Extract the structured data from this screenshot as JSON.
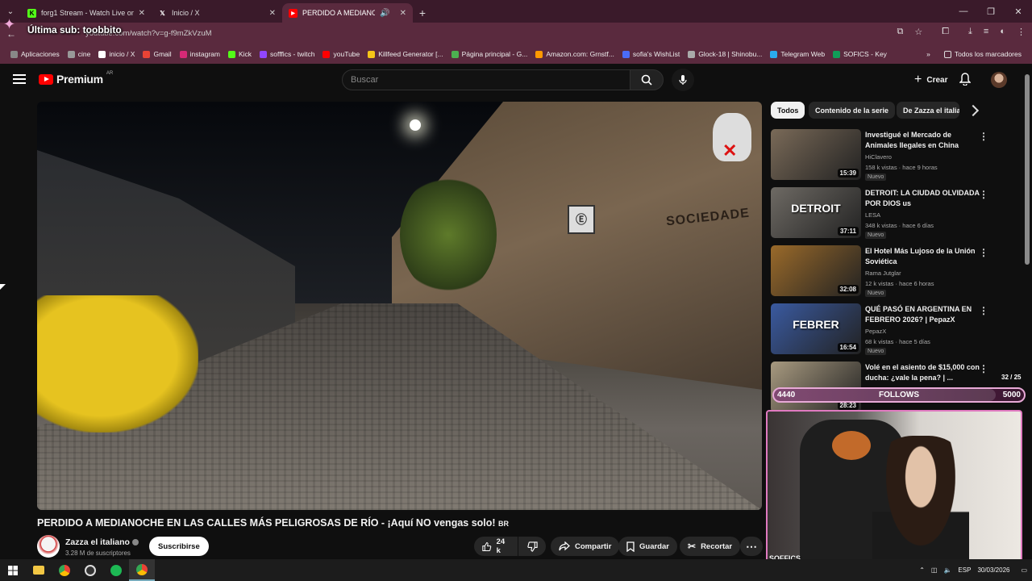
{
  "browser": {
    "tabs": [
      {
        "title": "forg1 Stream - Watch Live on K",
        "favicon": "kick-icon",
        "color": "#53fc18"
      },
      {
        "title": "Inicio / X",
        "favicon": "x-icon",
        "color": "#ffffff"
      },
      {
        "title": "PERDIDO A MEDIANOCHE",
        "favicon": "youtube-icon",
        "color": "#ff0000"
      }
    ],
    "url": "youtube.com/watch?v=g-f9mZkVzuM",
    "bookmarks": [
      {
        "label": "Aplicaciones",
        "color": "#888888"
      },
      {
        "label": "cine",
        "color": "#999999"
      },
      {
        "label": "inicio / X",
        "color": "#ffffff"
      },
      {
        "label": "Gmail",
        "color": "#ea4335"
      },
      {
        "label": "instagram",
        "color": "#d62976"
      },
      {
        "label": "Kick",
        "color": "#53fc18"
      },
      {
        "label": "sofffics - twitch",
        "color": "#9146ff"
      },
      {
        "label": "youTube",
        "color": "#ff0000"
      },
      {
        "label": "Killfeed Generator [...",
        "color": "#f5c518"
      },
      {
        "label": "Página principal - G...",
        "color": "#4caf50"
      },
      {
        "label": "Amazon.com: Grnstf...",
        "color": "#ff9900"
      },
      {
        "label": "sofia's WishList",
        "color": "#4a6cf7"
      },
      {
        "label": "Glock-18 | Shinobu...",
        "color": "#aaaaaa"
      },
      {
        "label": "Telegram Web",
        "color": "#2aabee"
      },
      {
        "label": "SOFICS - Key",
        "color": "#0f9d58"
      }
    ],
    "bookmarks_all": "Todos los marcadores"
  },
  "overlay": {
    "last_sub": "Última sub: toobbito",
    "follows_label": "FOLLOWS",
    "follows_current": "4440",
    "follows_goal": "5000",
    "follows_fraction": 0.888,
    "subs_count": "32 / 25",
    "cam_label": "SOFFICS"
  },
  "youtube": {
    "logo_text": "Premium",
    "logo_country": "AR",
    "search_placeholder": "Buscar",
    "create_label": "Crear",
    "video_title": "PERDIDO A MEDIANOCHE EN LAS CALLES MÁS PELIGROSAS DE RÍO - ¡Aquí NO vengas solo!",
    "video_title_flag": "BR",
    "channel_name": "Zazza el italiano",
    "channel_subs": "3.28 M de suscriptores",
    "subscribe_label": "Suscribirse",
    "likes": "24 k",
    "share_label": "Compartir",
    "save_label": "Guardar",
    "clip_label": "Recortar",
    "video_sign_text": "SOCIEDADE",
    "chips": [
      "Todos",
      "Contenido de la serie",
      "De Zazza el italiano"
    ],
    "recommended": [
      {
        "title": "Investigué el Mercado de Animales Ilegales en China",
        "channel": "HiClavero",
        "meta": "158 k vistas · hace 9 horas",
        "badge": "Nuevo",
        "duration": "15:39",
        "thumb": "#7a6a58"
      },
      {
        "title": "DETROIT: LA CIUDAD OLVIDADA POR DIOS us",
        "channel": "LESA",
        "meta": "348 k vistas · hace 6 días",
        "badge": "Nuevo",
        "duration": "37:11",
        "thumb": "#6e6a64",
        "overlay": "DETROIT"
      },
      {
        "title": "El Hotel Más Lujoso de la Unión Soviética",
        "channel": "Rama Jutglar",
        "meta": "12 k vistas · hace 6 horas",
        "badge": "Nuevo",
        "duration": "32:08",
        "thumb": "#9a6a2a"
      },
      {
        "title": "QUÉ PASÓ EN ARGENTINA EN FEBRERO 2026? | PepazX",
        "channel": "PepazX",
        "meta": "68 k vistas · hace 5 días",
        "badge": "Nuevo",
        "duration": "16:54",
        "thumb": "#3a5aa0",
        "overlay": "FEBRER"
      },
      {
        "title": "Volé en el asiento de $15,000 con ducha: ¿vale la pena? | ...",
        "channel": "",
        "meta": "",
        "badge": "",
        "duration": "28:23",
        "thumb": "#a89a80"
      }
    ]
  },
  "taskbar": {
    "lang": "ESP",
    "date": "30/03/2026"
  }
}
